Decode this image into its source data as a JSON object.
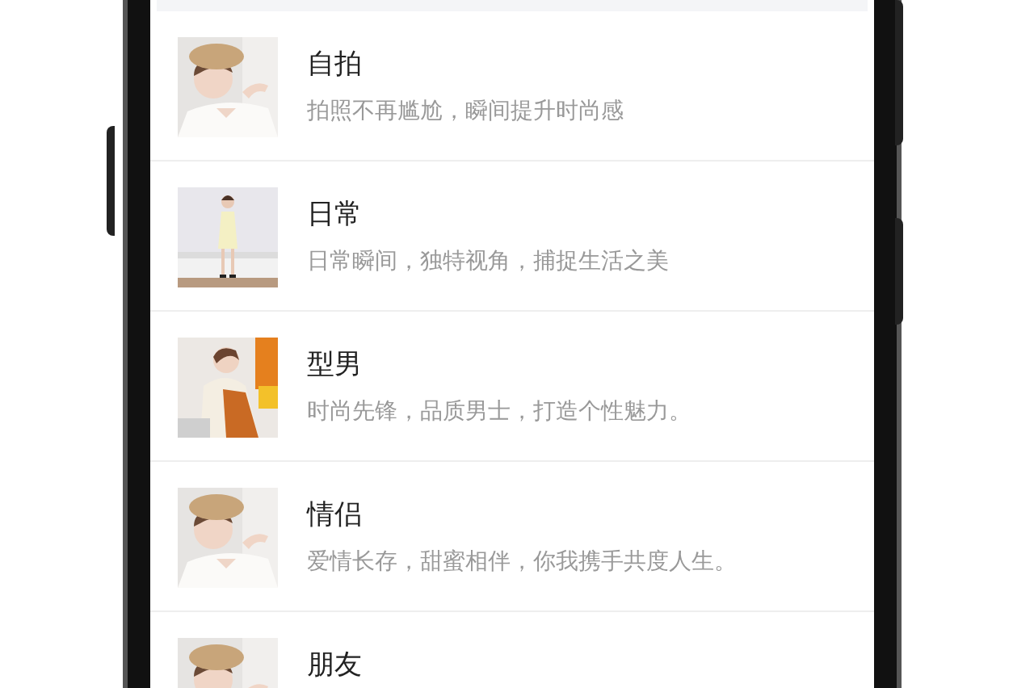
{
  "list": [
    {
      "title": "自拍",
      "subtitle": "拍照不再尴尬，瞬间提升时尚感"
    },
    {
      "title": "日常",
      "subtitle": "日常瞬间，独特视角，捕捉生活之美"
    },
    {
      "title": "型男",
      "subtitle": "时尚先锋，品质男士，打造个性魅力。"
    },
    {
      "title": "情侣",
      "subtitle": "爱情长存，甜蜜相伴，你我携手共度人生。"
    },
    {
      "title": "朋友"
    }
  ]
}
